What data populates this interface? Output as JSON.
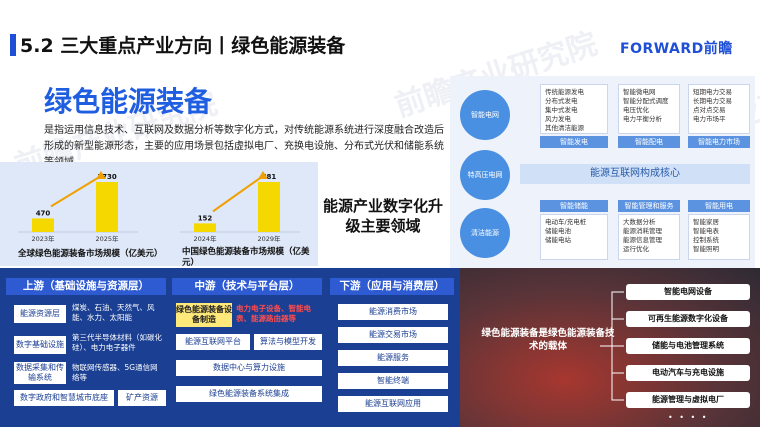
{
  "header": {
    "title": "5.2 三大重点产业方向丨绿色能源装备",
    "logo_en": "FORWARD",
    "logo_cn": "前瞻",
    "watermark": "前瞻产业研究院"
  },
  "intro": {
    "title": "绿色能源装备",
    "description": "是指运用信息技术、互联网及数据分析等数字化方式，对传统能源系统进行深度融合改造后形成的新型能源形态，主要的应用场景包括虚拟电厂、充换电设施、分布式光伏和储能系统等领域。"
  },
  "mid_label": "能源产业数字化升级主要领域",
  "chart_data": [
    {
      "type": "bar",
      "title": "全球绿色能源装备市场规模（亿美元）",
      "categories": [
        "2023年",
        "2025年"
      ],
      "values": [
        470,
        1730
      ],
      "color": "#f5d800"
    },
    {
      "type": "bar",
      "title": "中国绿色能源装备市场规模（亿美元）",
      "categories": [
        "2024年",
        "2029年"
      ],
      "values": [
        152,
        881
      ],
      "color": "#f5d800"
    }
  ],
  "diagram": {
    "circles": [
      "智能电网",
      "特高压电网",
      "清洁能源"
    ],
    "top_groups": [
      {
        "items": [
          "传统能源发电",
          "分布式发电",
          "集中式发电",
          "风力发电",
          "其他清洁能源"
        ],
        "head": "智能发电"
      },
      {
        "items": [
          "智能微电网",
          "智能分配式调度",
          "电压优化",
          "电力平衡分析"
        ],
        "head": "智能配电"
      },
      {
        "items": [
          "短期电力交易",
          "长期电力交易",
          "点对点交易",
          "电力市场平"
        ],
        "head": "智能电力市场"
      }
    ],
    "core": "能源互联网构成核心",
    "bottom_groups": [
      {
        "head": "智能储能",
        "items": [
          "电动车/充电桩",
          "储能电池",
          "储能电站"
        ]
      },
      {
        "head": "智能管理和服务",
        "items": [
          "大数据分析",
          "能源消耗管理",
          "能源信息管理",
          "运行优化"
        ]
      },
      {
        "head": "智能用电",
        "items": [
          "智能家居",
          "智能电表",
          "控制系统",
          "智能照明"
        ]
      }
    ]
  },
  "industry": {
    "upstream": {
      "head": "上游（基础设施与资源层）",
      "rows": [
        {
          "cell": "能源资源层",
          "text": "煤炭、石油、天然气、风能、水力、太阳能"
        },
        {
          "cell": "数字基础设施",
          "text": "第三代半导体材料（如碳化硅）、电力电子器件"
        },
        {
          "cell": "数据采集和传输系统",
          "text": "物联网传感器、5G通信网络等"
        }
      ],
      "bottom": [
        "数字政府和智慧城市底座",
        "矿产资源"
      ]
    },
    "midstream": {
      "head": "中游（技术与平台层）",
      "highlight": "绿色能源装备设备制造",
      "highlight_note": "电力电子设备、智能电表、能源路由器等",
      "cells": [
        "能源互联网平台",
        "算法与模型开发",
        "数据中心与算力设施",
        "绿色能源装备系统集成"
      ]
    },
    "downstream": {
      "head": "下游（应用与消费层）",
      "cells": [
        "能源消费市场",
        "能源交易市场",
        "能源服务",
        "智能终端",
        "能源互联网应用"
      ]
    }
  },
  "carrier": {
    "title": "绿色能源装备是绿色能源装备技术的载体",
    "items": [
      "智能电网设备",
      "可再生能源数字化设备",
      "储能与电池管理系统",
      "电动汽车与充电设施",
      "能源管理与虚拟电厂"
    ],
    "dots": "• • • •"
  }
}
